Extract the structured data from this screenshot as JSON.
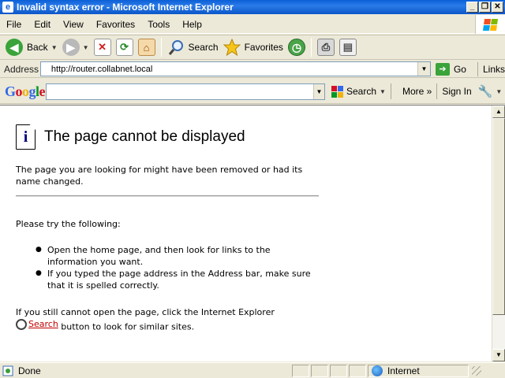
{
  "window": {
    "title": "Invalid syntax error - Microsoft Internet Explorer",
    "controls": {
      "minimize": "_",
      "restore": "❐",
      "close": "✕"
    }
  },
  "menu": [
    "File",
    "Edit",
    "View",
    "Favorites",
    "Tools",
    "Help"
  ],
  "toolbar": {
    "back_label": "Back",
    "search_label": "Search",
    "favorites_label": "Favorites"
  },
  "address": {
    "label": "Address",
    "value": "http://router.collabnet.local",
    "go_label": "Go",
    "links_label": "Links"
  },
  "google": {
    "logo": "Google",
    "placeholder": "",
    "search_label": "Search",
    "more_label": "More »",
    "signin_label": "Sign In"
  },
  "page": {
    "title": "The page cannot be displayed",
    "intro": "The page you are looking for might have been removed or had its name changed.",
    "try_heading": "Please try the following:",
    "tips": [
      "Open the home page, and then look for links to the information you want.",
      "If you typed the page address in the Address bar, make sure that it is spelled correctly."
    ],
    "footer_before": "If you still cannot open the page, click the Internet Explorer",
    "search_link": "Search",
    "footer_after": "button to look for similar sites."
  },
  "status": {
    "text": "Done",
    "zone": "Internet"
  },
  "colors": {
    "titlebar": "#0a5fd7",
    "back_green": "#3aa33a",
    "link_red": "#c00000"
  }
}
